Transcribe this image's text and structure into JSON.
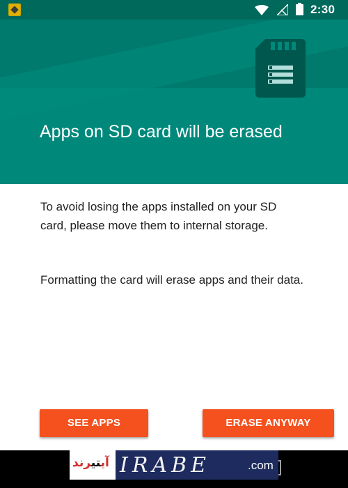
{
  "status_bar": {
    "time": "2:30",
    "icons": [
      "app-notification-icon",
      "wifi-icon",
      "signal-icon",
      "battery-icon"
    ]
  },
  "dialog": {
    "title": "Apps on SD card will be erased",
    "paragraph1": "To avoid losing the apps installed on your SD card, please move them to internal storage.",
    "paragraph2": "Formatting the card will erase apps and their data.",
    "see_apps_label": "SEE APPS",
    "erase_anyway_label": "ERASE ANYWAY"
  },
  "watermark": {
    "persian_red": "آی",
    "persian_dark": "تی",
    "persian_red2": "رند",
    "letters": "IRABE",
    "domain": ".com"
  },
  "colors": {
    "header": "#00897b",
    "status_bar": "#00695c",
    "button": "#f4511e",
    "body_text": "#212121"
  }
}
